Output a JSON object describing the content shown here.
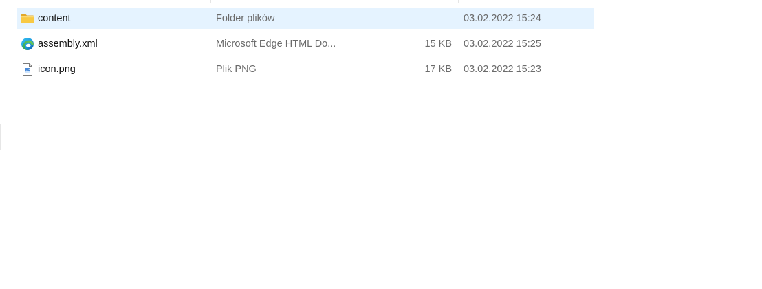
{
  "files": [
    {
      "name": "content",
      "type": "Folder plików",
      "size": "",
      "modified": "03.02.2022 15:24",
      "icon": "folder-icon",
      "selected": true
    },
    {
      "name": "assembly.xml",
      "type": "Microsoft Edge HTML Do...",
      "size": "15 KB",
      "modified": "03.02.2022 15:25",
      "icon": "edge-icon",
      "selected": false
    },
    {
      "name": "icon.png",
      "type": "Plik PNG",
      "size": "17 KB",
      "modified": "03.02.2022 15:23",
      "icon": "png-file-icon",
      "selected": false
    }
  ],
  "colors": {
    "selection": "#e5f3ff",
    "secondary_text": "#6b6b6b",
    "folder": "#f8c944"
  }
}
